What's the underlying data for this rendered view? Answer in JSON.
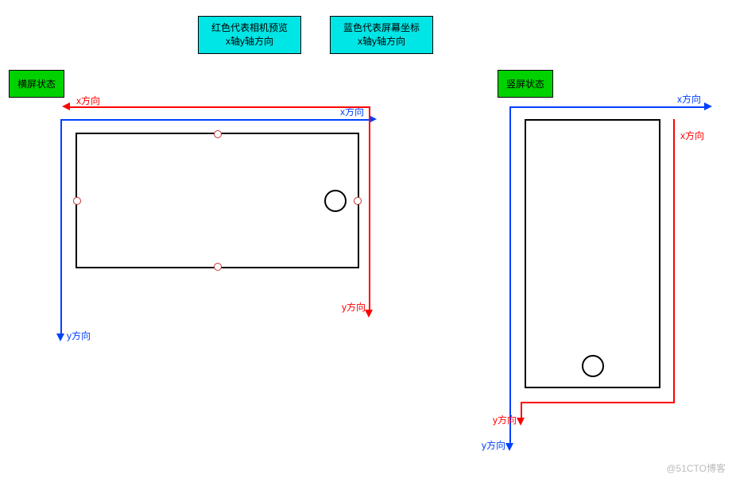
{
  "legend": {
    "camera": {
      "line1": "红色代表相机预览",
      "line2": "x轴y轴方向"
    },
    "screen": {
      "line1": "蓝色代表屏幕坐标",
      "line2": "x轴y轴方向"
    }
  },
  "states": {
    "landscape": "横屏状态",
    "portrait": "竖屏状态"
  },
  "axes": {
    "x": "x方向",
    "y": "y方向"
  },
  "watermark": "@51CTO博客",
  "colors": {
    "camera": "#ff0000",
    "screen": "#0040ff",
    "state_bg": "#00d200",
    "legend_bg": "#00e5e5"
  }
}
